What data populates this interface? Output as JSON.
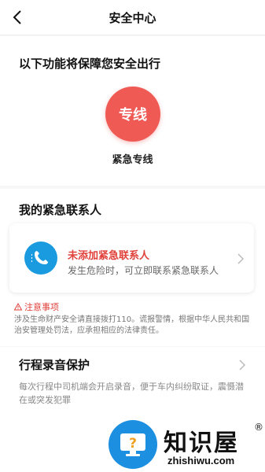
{
  "header": {
    "title": "安全中心"
  },
  "intro": {
    "title": "以下功能将保障您安全出行",
    "hotline_button_text": "专线",
    "hotline_label": "紧急专线"
  },
  "contacts": {
    "section_title": "我的紧急联系人",
    "card_title": "未添加紧急联系人",
    "card_subtitle": "发生危险时，可立即联系紧急联系人"
  },
  "notice": {
    "title": "注意事项",
    "body": "涉及生命财产安全请直接拨打110。谎报警情，根据中华人民共和国治安管理处罚法，应承担相应的法律责任。"
  },
  "recording": {
    "title": "行程录音保护",
    "description": "每次行程中司机端会开启录音，便于车内纠纷取证，震慑潜在或突发犯罪"
  },
  "watermark": {
    "name": "知识屋",
    "registered": "®",
    "domain": "zhishiwu.com"
  },
  "colors": {
    "hotline": "#ef5a55",
    "phone_icon_bg": "#1a9be0",
    "alert_red": "#e0413b"
  }
}
